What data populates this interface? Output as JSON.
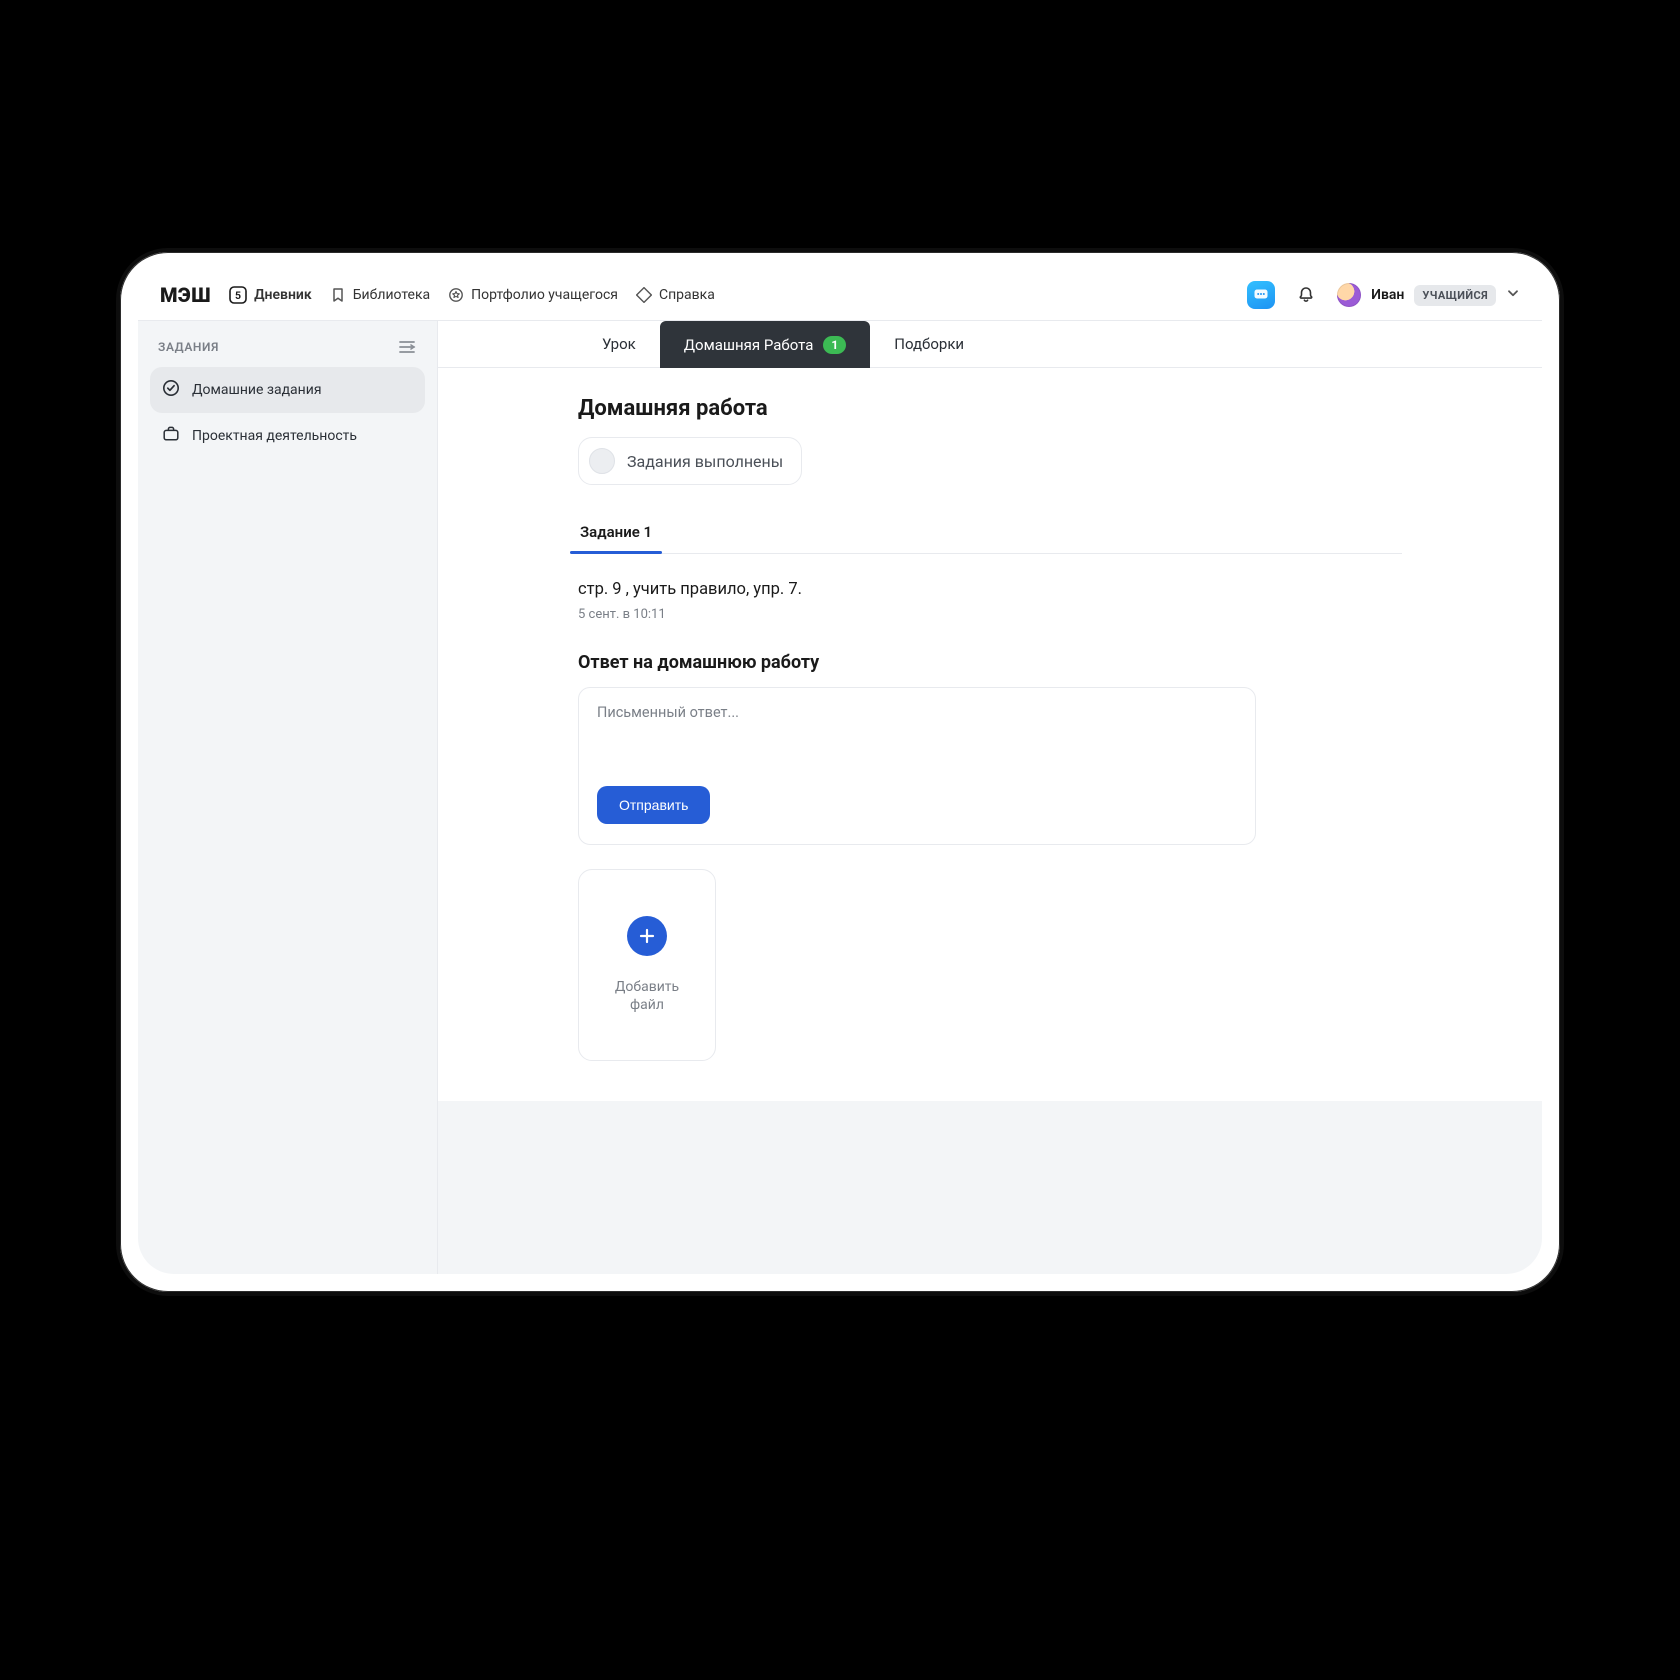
{
  "brand": "МЭШ",
  "nav": {
    "diary": "Дневник",
    "diary_badge": "5",
    "library": "Библиотека",
    "portfolio": "Портфолио учащегося",
    "help": "Справка"
  },
  "user": {
    "name": "Иван",
    "role": "УЧАЩИЙСЯ"
  },
  "sidebar": {
    "heading": "ЗАДАНИЯ",
    "items": [
      {
        "label": "Домашние задания"
      },
      {
        "label": "Проектная деятельность"
      }
    ]
  },
  "tabs": {
    "lesson": "Урок",
    "homework": "Домашняя Работа",
    "homework_badge": "1",
    "collections": "Подборки"
  },
  "page": {
    "title": "Домашняя работа",
    "done_label": "Задания выполнены"
  },
  "subtabs": [
    {
      "label": "Задание 1"
    }
  ],
  "homework": {
    "text": "стр. 9 , учить правило, упр. 7.",
    "meta": "5 сент. в 10:11"
  },
  "answer": {
    "title": "Ответ на домашнюю работу",
    "placeholder": "Письменный ответ...",
    "submit": "Отправить"
  },
  "file": {
    "add_line1": "Добавить",
    "add_line2": "файл"
  }
}
